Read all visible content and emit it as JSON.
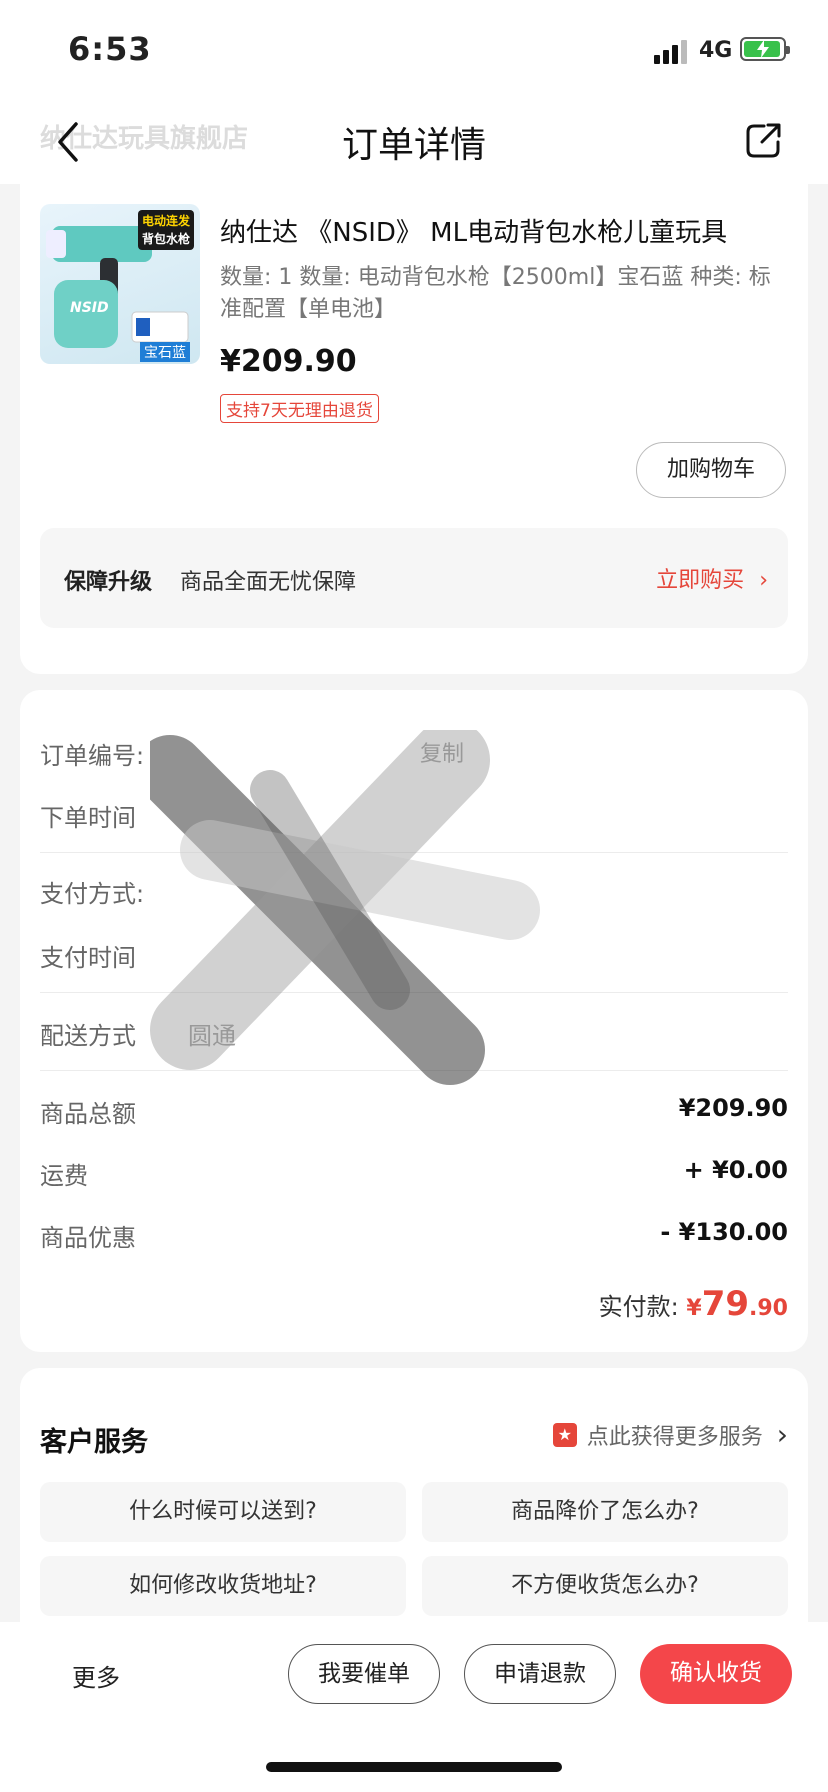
{
  "status_bar": {
    "time": "6:53",
    "network": "4G"
  },
  "nav": {
    "store_name": "纳仕达玩具旗舰店",
    "title": "订单详情"
  },
  "product": {
    "image_badge_line1": "电动连发",
    "image_badge_line2": "背包水枪",
    "image_tag": "宝石蓝",
    "image_brand": "NSID",
    "title": "纳仕达 《NSID》 ML电动背包水枪儿童玩具",
    "spec": "数量: 1  数量: 电动背包水枪【2500ml】宝石蓝  种类: 标准配置【单电池】",
    "price": "¥209.90",
    "return_badge": "支持7天无理由退货",
    "add_cart_label": "加购物车"
  },
  "guarantee": {
    "title": "保障升级",
    "desc": "商品全面无忧保障",
    "link": "立即购买"
  },
  "order_info": {
    "order_no_label": "订单编号:",
    "copy_label": "复制",
    "order_time_label": "下单时间",
    "pay_method_label": "支付方式:",
    "pay_time_label": "支付时间",
    "delivery_label": "配送方式",
    "delivery_value": "圆通"
  },
  "amounts": {
    "subtotal_label": "商品总额",
    "subtotal_value": "¥209.90",
    "shipping_label": "运费",
    "shipping_value": "+ ¥0.00",
    "discount_label": "商品优惠",
    "discount_value": "- ¥130.00",
    "paid_label": "实付款:",
    "paid_currency": "¥",
    "paid_int": "79",
    "paid_dec": ".90"
  },
  "customer_service": {
    "title": "客户服务",
    "more_label": "点此获得更多服务",
    "faqs": [
      "什么时候可以送到?",
      "商品降价了怎么办?",
      "如何修改收货地址?",
      "不方便收货怎么办?"
    ]
  },
  "bottom_bar": {
    "more": "更多",
    "urge": "我要催单",
    "refund": "申请退款",
    "confirm": "确认收货"
  },
  "colors": {
    "accent": "#e5463a",
    "primary_button": "#f4464a",
    "background": "#f4f4f4"
  }
}
